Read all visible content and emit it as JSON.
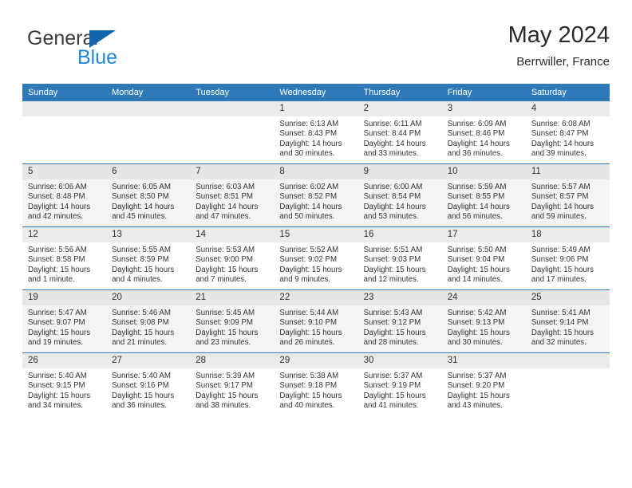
{
  "brand": {
    "name_top": "General",
    "name_bottom": "Blue",
    "triangle_color": "#1264ac",
    "blue_color": "#1f86d4"
  },
  "header": {
    "title": "May 2024",
    "subtitle": "Berrwiller, France"
  },
  "theme": {
    "header_blue": "#3079b8",
    "row_shaded": "#f4f4f4",
    "daynum_band": "#ebebeb"
  },
  "weekday_headers": [
    "Sunday",
    "Monday",
    "Tuesday",
    "Wednesday",
    "Thursday",
    "Friday",
    "Saturday"
  ],
  "labels": {
    "sunrise_prefix": "Sunrise:",
    "sunset_prefix": "Sunset:",
    "daylight_prefix": "Daylight:"
  },
  "weeks": [
    {
      "shaded": false,
      "days": [
        {
          "num": "",
          "empty": true,
          "sunrise": "",
          "sunset": "",
          "daylight_line1": "",
          "daylight_line2": ""
        },
        {
          "num": "",
          "empty": true,
          "sunrise": "",
          "sunset": "",
          "daylight_line1": "",
          "daylight_line2": ""
        },
        {
          "num": "",
          "empty": true,
          "sunrise": "",
          "sunset": "",
          "daylight_line1": "",
          "daylight_line2": ""
        },
        {
          "num": "1",
          "empty": false,
          "sunrise": "Sunrise: 6:13 AM",
          "sunset": "Sunset: 8:43 PM",
          "daylight_line1": "Daylight: 14 hours",
          "daylight_line2": "and 30 minutes."
        },
        {
          "num": "2",
          "empty": false,
          "sunrise": "Sunrise: 6:11 AM",
          "sunset": "Sunset: 8:44 PM",
          "daylight_line1": "Daylight: 14 hours",
          "daylight_line2": "and 33 minutes."
        },
        {
          "num": "3",
          "empty": false,
          "sunrise": "Sunrise: 6:09 AM",
          "sunset": "Sunset: 8:46 PM",
          "daylight_line1": "Daylight: 14 hours",
          "daylight_line2": "and 36 minutes."
        },
        {
          "num": "4",
          "empty": false,
          "sunrise": "Sunrise: 6:08 AM",
          "sunset": "Sunset: 8:47 PM",
          "daylight_line1": "Daylight: 14 hours",
          "daylight_line2": "and 39 minutes."
        }
      ]
    },
    {
      "shaded": true,
      "days": [
        {
          "num": "5",
          "empty": false,
          "sunrise": "Sunrise: 6:06 AM",
          "sunset": "Sunset: 8:48 PM",
          "daylight_line1": "Daylight: 14 hours",
          "daylight_line2": "and 42 minutes."
        },
        {
          "num": "6",
          "empty": false,
          "sunrise": "Sunrise: 6:05 AM",
          "sunset": "Sunset: 8:50 PM",
          "daylight_line1": "Daylight: 14 hours",
          "daylight_line2": "and 45 minutes."
        },
        {
          "num": "7",
          "empty": false,
          "sunrise": "Sunrise: 6:03 AM",
          "sunset": "Sunset: 8:51 PM",
          "daylight_line1": "Daylight: 14 hours",
          "daylight_line2": "and 47 minutes."
        },
        {
          "num": "8",
          "empty": false,
          "sunrise": "Sunrise: 6:02 AM",
          "sunset": "Sunset: 8:52 PM",
          "daylight_line1": "Daylight: 14 hours",
          "daylight_line2": "and 50 minutes."
        },
        {
          "num": "9",
          "empty": false,
          "sunrise": "Sunrise: 6:00 AM",
          "sunset": "Sunset: 8:54 PM",
          "daylight_line1": "Daylight: 14 hours",
          "daylight_line2": "and 53 minutes."
        },
        {
          "num": "10",
          "empty": false,
          "sunrise": "Sunrise: 5:59 AM",
          "sunset": "Sunset: 8:55 PM",
          "daylight_line1": "Daylight: 14 hours",
          "daylight_line2": "and 56 minutes."
        },
        {
          "num": "11",
          "empty": false,
          "sunrise": "Sunrise: 5:57 AM",
          "sunset": "Sunset: 8:57 PM",
          "daylight_line1": "Daylight: 14 hours",
          "daylight_line2": "and 59 minutes."
        }
      ]
    },
    {
      "shaded": false,
      "days": [
        {
          "num": "12",
          "empty": false,
          "sunrise": "Sunrise: 5:56 AM",
          "sunset": "Sunset: 8:58 PM",
          "daylight_line1": "Daylight: 15 hours",
          "daylight_line2": "and 1 minute."
        },
        {
          "num": "13",
          "empty": false,
          "sunrise": "Sunrise: 5:55 AM",
          "sunset": "Sunset: 8:59 PM",
          "daylight_line1": "Daylight: 15 hours",
          "daylight_line2": "and 4 minutes."
        },
        {
          "num": "14",
          "empty": false,
          "sunrise": "Sunrise: 5:53 AM",
          "sunset": "Sunset: 9:00 PM",
          "daylight_line1": "Daylight: 15 hours",
          "daylight_line2": "and 7 minutes."
        },
        {
          "num": "15",
          "empty": false,
          "sunrise": "Sunrise: 5:52 AM",
          "sunset": "Sunset: 9:02 PM",
          "daylight_line1": "Daylight: 15 hours",
          "daylight_line2": "and 9 minutes."
        },
        {
          "num": "16",
          "empty": false,
          "sunrise": "Sunrise: 5:51 AM",
          "sunset": "Sunset: 9:03 PM",
          "daylight_line1": "Daylight: 15 hours",
          "daylight_line2": "and 12 minutes."
        },
        {
          "num": "17",
          "empty": false,
          "sunrise": "Sunrise: 5:50 AM",
          "sunset": "Sunset: 9:04 PM",
          "daylight_line1": "Daylight: 15 hours",
          "daylight_line2": "and 14 minutes."
        },
        {
          "num": "18",
          "empty": false,
          "sunrise": "Sunrise: 5:49 AM",
          "sunset": "Sunset: 9:06 PM",
          "daylight_line1": "Daylight: 15 hours",
          "daylight_line2": "and 17 minutes."
        }
      ]
    },
    {
      "shaded": true,
      "days": [
        {
          "num": "19",
          "empty": false,
          "sunrise": "Sunrise: 5:47 AM",
          "sunset": "Sunset: 9:07 PM",
          "daylight_line1": "Daylight: 15 hours",
          "daylight_line2": "and 19 minutes."
        },
        {
          "num": "20",
          "empty": false,
          "sunrise": "Sunrise: 5:46 AM",
          "sunset": "Sunset: 9:08 PM",
          "daylight_line1": "Daylight: 15 hours",
          "daylight_line2": "and 21 minutes."
        },
        {
          "num": "21",
          "empty": false,
          "sunrise": "Sunrise: 5:45 AM",
          "sunset": "Sunset: 9:09 PM",
          "daylight_line1": "Daylight: 15 hours",
          "daylight_line2": "and 23 minutes."
        },
        {
          "num": "22",
          "empty": false,
          "sunrise": "Sunrise: 5:44 AM",
          "sunset": "Sunset: 9:10 PM",
          "daylight_line1": "Daylight: 15 hours",
          "daylight_line2": "and 26 minutes."
        },
        {
          "num": "23",
          "empty": false,
          "sunrise": "Sunrise: 5:43 AM",
          "sunset": "Sunset: 9:12 PM",
          "daylight_line1": "Daylight: 15 hours",
          "daylight_line2": "and 28 minutes."
        },
        {
          "num": "24",
          "empty": false,
          "sunrise": "Sunrise: 5:42 AM",
          "sunset": "Sunset: 9:13 PM",
          "daylight_line1": "Daylight: 15 hours",
          "daylight_line2": "and 30 minutes."
        },
        {
          "num": "25",
          "empty": false,
          "sunrise": "Sunrise: 5:41 AM",
          "sunset": "Sunset: 9:14 PM",
          "daylight_line1": "Daylight: 15 hours",
          "daylight_line2": "and 32 minutes."
        }
      ]
    },
    {
      "shaded": false,
      "days": [
        {
          "num": "26",
          "empty": false,
          "sunrise": "Sunrise: 5:40 AM",
          "sunset": "Sunset: 9:15 PM",
          "daylight_line1": "Daylight: 15 hours",
          "daylight_line2": "and 34 minutes."
        },
        {
          "num": "27",
          "empty": false,
          "sunrise": "Sunrise: 5:40 AM",
          "sunset": "Sunset: 9:16 PM",
          "daylight_line1": "Daylight: 15 hours",
          "daylight_line2": "and 36 minutes."
        },
        {
          "num": "28",
          "empty": false,
          "sunrise": "Sunrise: 5:39 AM",
          "sunset": "Sunset: 9:17 PM",
          "daylight_line1": "Daylight: 15 hours",
          "daylight_line2": "and 38 minutes."
        },
        {
          "num": "29",
          "empty": false,
          "sunrise": "Sunrise: 5:38 AM",
          "sunset": "Sunset: 9:18 PM",
          "daylight_line1": "Daylight: 15 hours",
          "daylight_line2": "and 40 minutes."
        },
        {
          "num": "30",
          "empty": false,
          "sunrise": "Sunrise: 5:37 AM",
          "sunset": "Sunset: 9:19 PM",
          "daylight_line1": "Daylight: 15 hours",
          "daylight_line2": "and 41 minutes."
        },
        {
          "num": "31",
          "empty": false,
          "sunrise": "Sunrise: 5:37 AM",
          "sunset": "Sunset: 9:20 PM",
          "daylight_line1": "Daylight: 15 hours",
          "daylight_line2": "and 43 minutes."
        },
        {
          "num": "",
          "empty": true,
          "sunrise": "",
          "sunset": "",
          "daylight_line1": "",
          "daylight_line2": ""
        }
      ]
    }
  ]
}
